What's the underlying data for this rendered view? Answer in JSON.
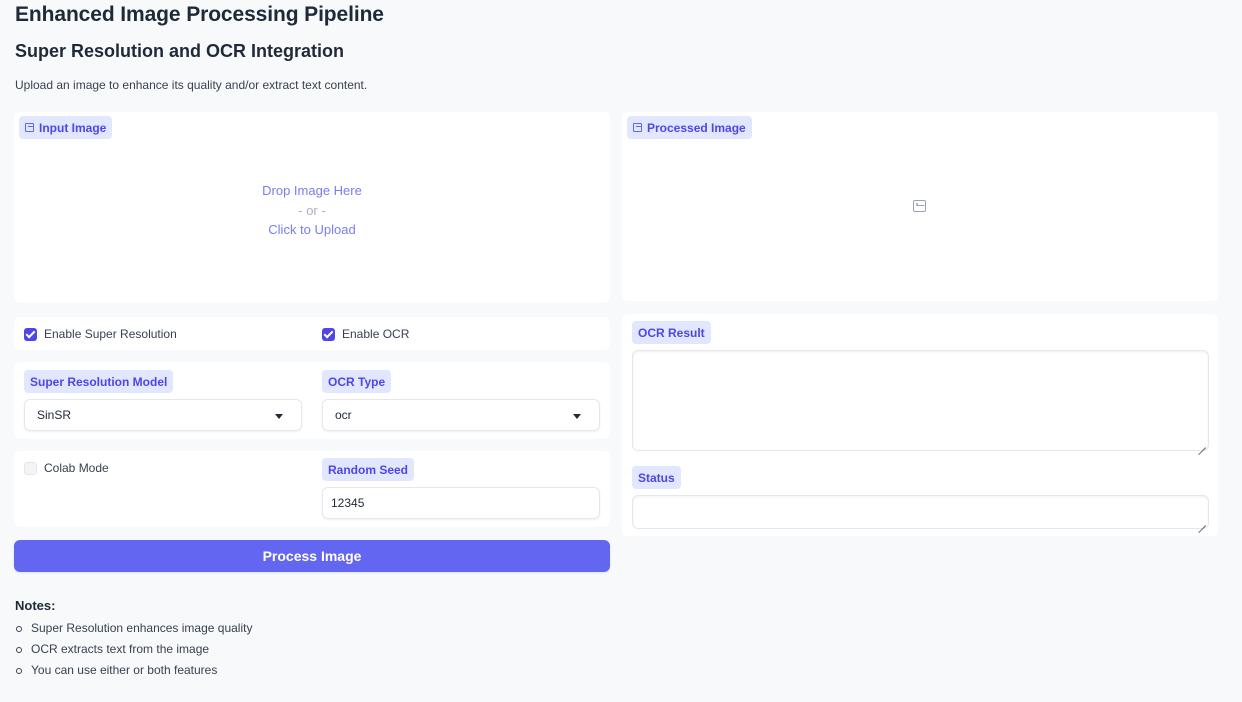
{
  "header": {
    "title": "Enhanced Image Processing Pipeline",
    "subtitle": "Super Resolution and OCR Integration",
    "description": "Upload an image to enhance its quality and/or extract text content."
  },
  "input_image": {
    "label": "Input Image",
    "icon": "image-icon",
    "drop_text": "Drop Image Here",
    "or_text": "- or -",
    "click_text": "Click to Upload"
  },
  "processed_image": {
    "label": "Processed Image",
    "icon": "image-icon"
  },
  "options": {
    "super_resolution": {
      "label": "Enable Super Resolution",
      "checked": true
    },
    "ocr": {
      "label": "Enable OCR",
      "checked": true
    },
    "colab_mode": {
      "label": "Colab Mode",
      "checked": false
    }
  },
  "model": {
    "label": "Super Resolution Model",
    "value": "SinSR"
  },
  "ocr_type": {
    "label": "OCR Type",
    "value": "ocr"
  },
  "seed": {
    "label": "Random Seed",
    "value": "12345"
  },
  "process_button": "Process Image",
  "outputs": {
    "ocr_result_label": "OCR Result",
    "ocr_result_value": "",
    "status_label": "Status",
    "status_value": ""
  },
  "notes": {
    "title": "Notes:",
    "items": [
      "Super Resolution enhances image quality",
      "OCR extracts text from the image",
      "You can use either or both features"
    ]
  },
  "colors": {
    "accent": "#6366f1",
    "badge_bg": "#e0e7ff",
    "badge_text": "#4f46e5",
    "page_bg": "#f8f9fb"
  }
}
